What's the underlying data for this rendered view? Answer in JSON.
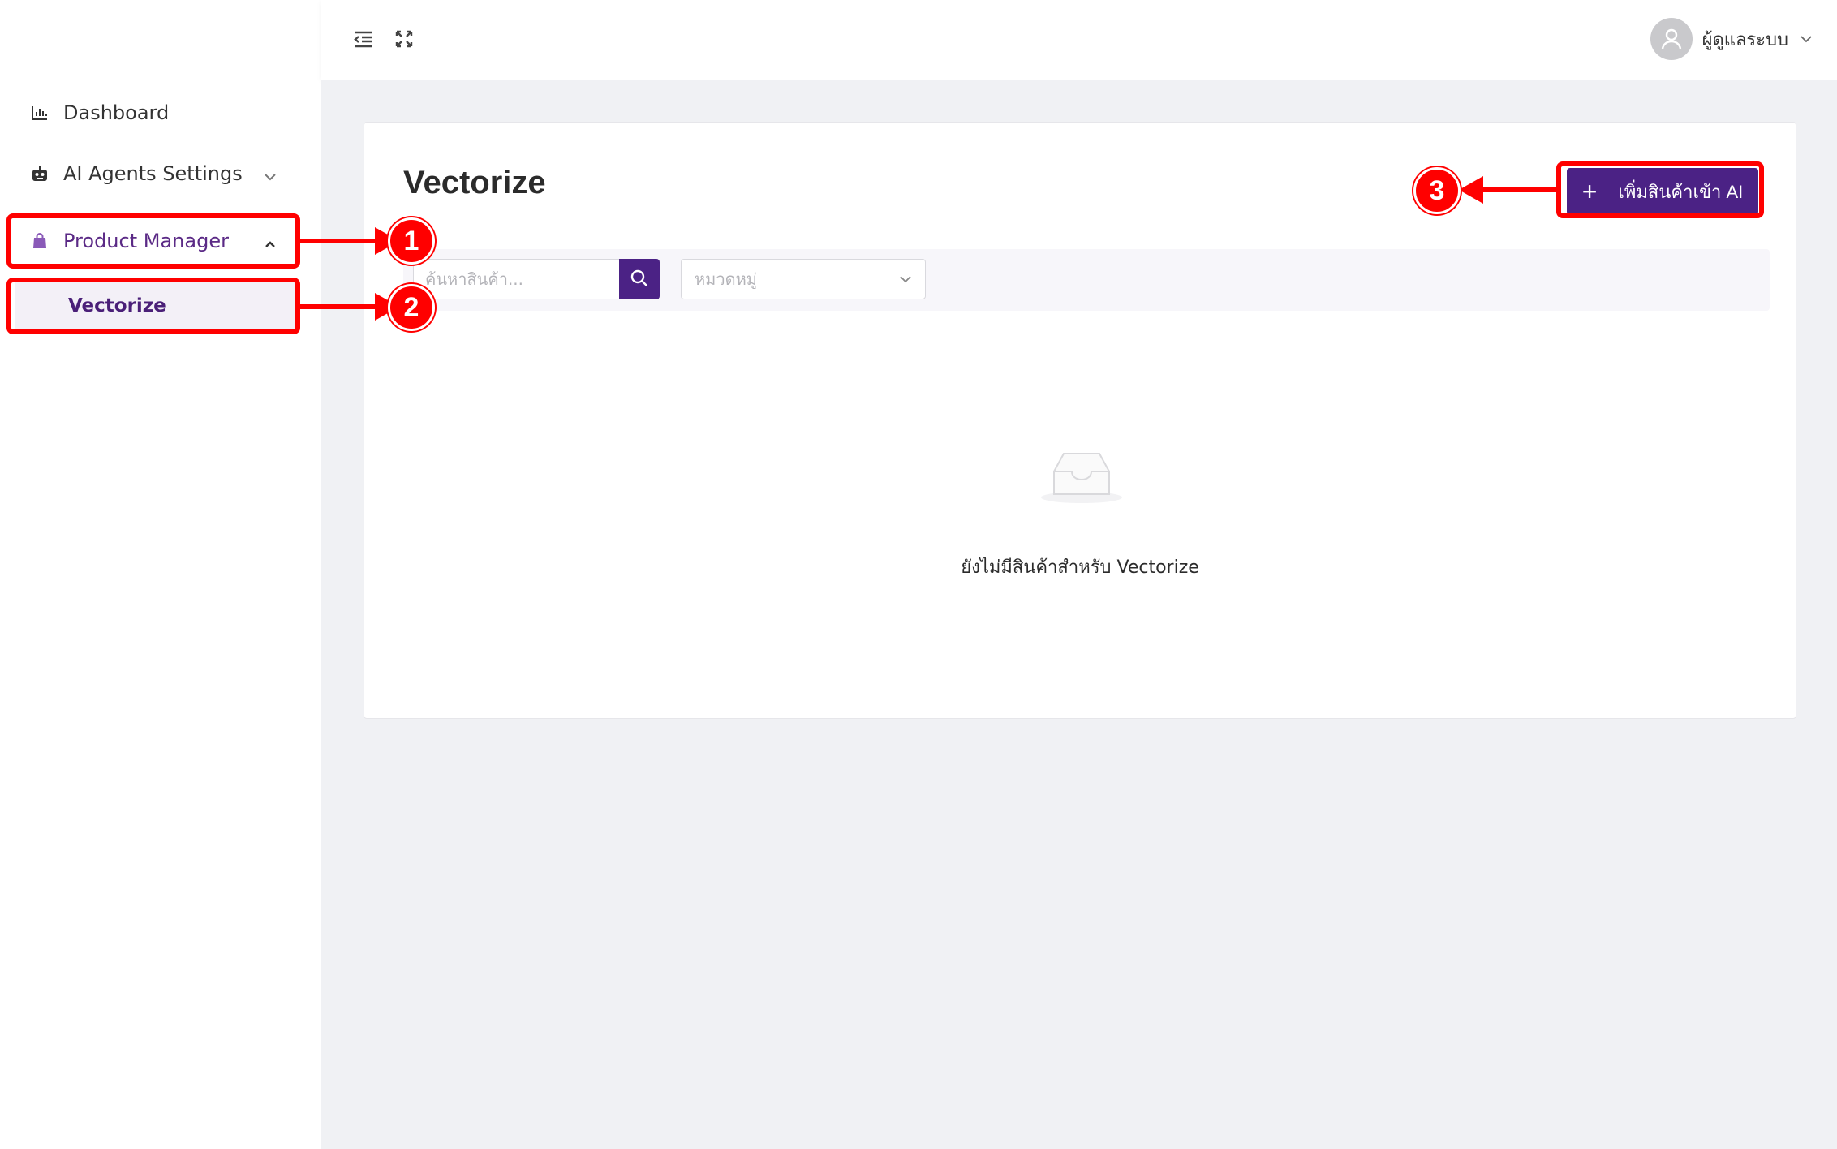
{
  "sidebar": {
    "items": [
      {
        "label": "Dashboard",
        "icon": "bar-chart-icon"
      },
      {
        "label": "AI Agents Settings",
        "icon": "robot-icon"
      },
      {
        "label": "Product Manager",
        "icon": "shopping-bag-icon"
      }
    ],
    "sub_items": [
      {
        "label": "Vectorize"
      }
    ]
  },
  "header": {
    "user_name": "ผู้ดูแลระบบ"
  },
  "main": {
    "title": "Vectorize",
    "add_button_label": "เพิ่มสินค้าเข้า AI",
    "search": {
      "placeholder": "ค้นหาสินค้า..."
    },
    "category": {
      "placeholder": "หมวดหมู่"
    },
    "empty_text": "ยังไม่มีสินค้าสำหรับ Vectorize"
  },
  "annotations": [
    "1",
    "2",
    "3"
  ],
  "colors": {
    "accent": "#4b2285",
    "annotation": "#ff0000",
    "background": "#f0f1f4"
  }
}
